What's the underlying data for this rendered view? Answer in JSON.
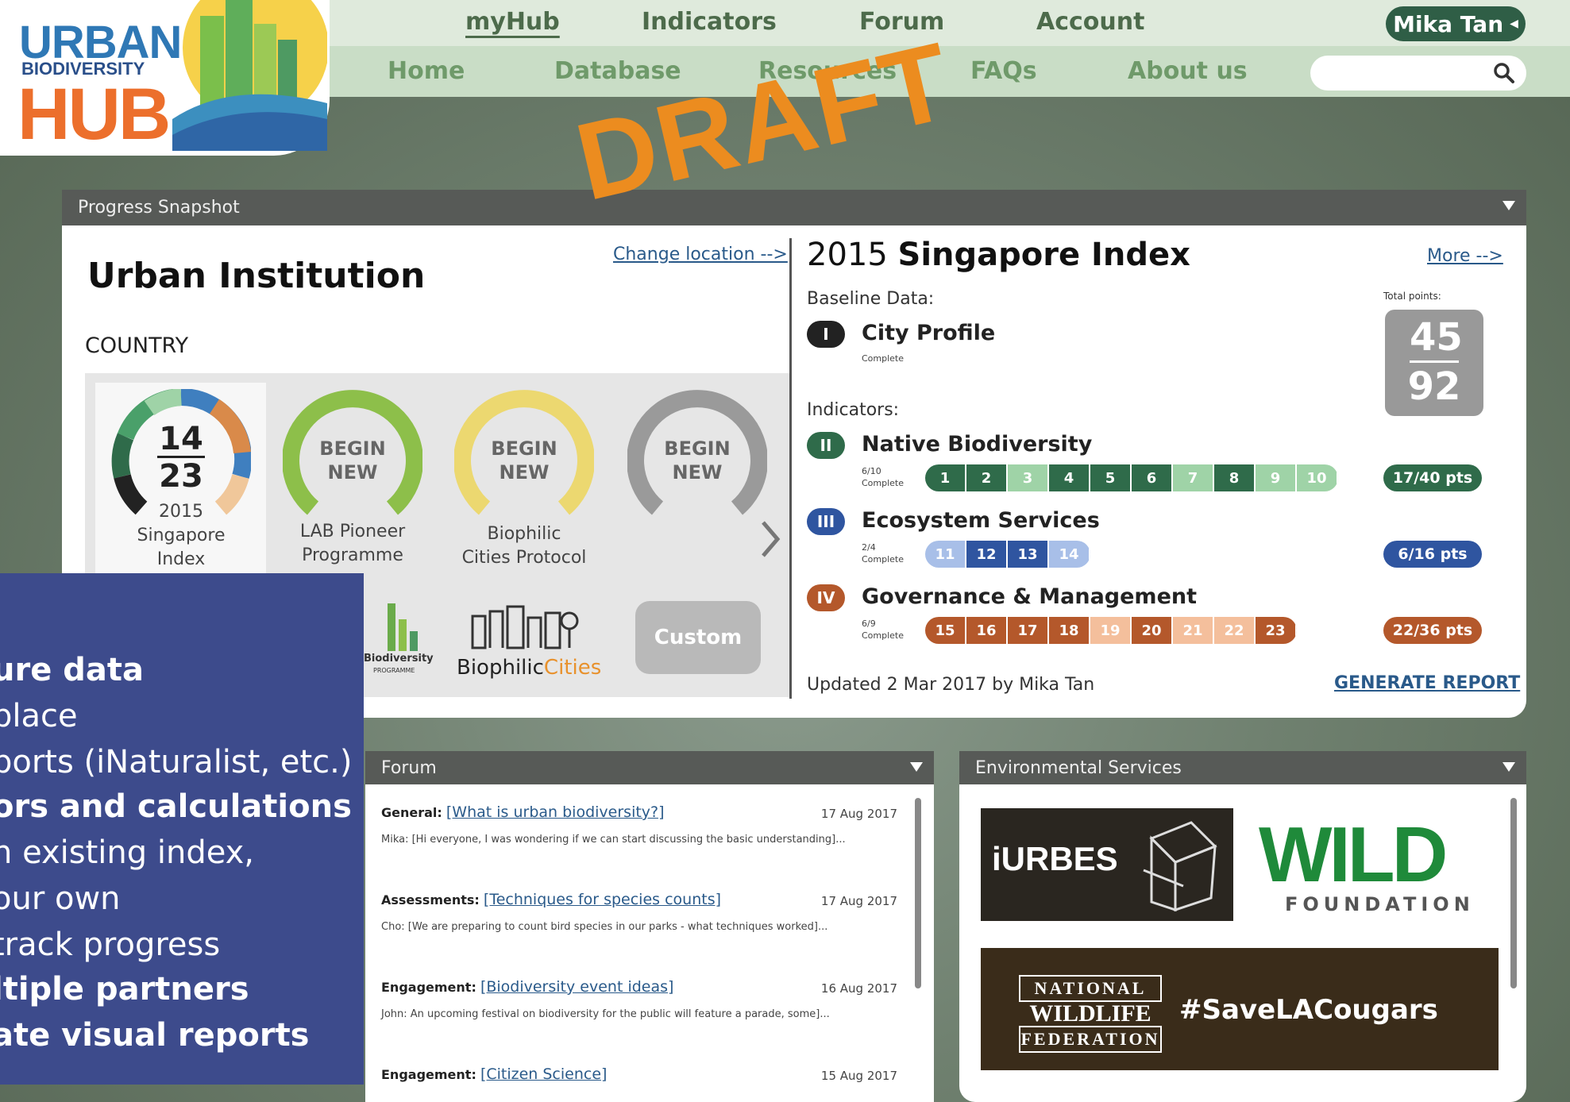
{
  "nav": {
    "top": [
      "myHub",
      "Indicators",
      "Forum",
      "Account"
    ],
    "sub": [
      "Home",
      "Database",
      "Resources",
      "FAQs",
      "About us"
    ],
    "user": "Mika Tan",
    "search_placeholder": ""
  },
  "logo": {
    "line1": "URBAN",
    "line2": "BIODIVERSITY",
    "line3": "HUB"
  },
  "watermark": "DRAFT",
  "snapshot": {
    "header": "Progress Snapshot",
    "institution": "Urban Institution",
    "country": "COUNTRY",
    "change_location": "Change location -->",
    "dials": [
      {
        "score": "14",
        "total": "23",
        "label": [
          "2015",
          "Singapore",
          "Index"
        ]
      },
      {
        "begin": [
          "BEGIN",
          "NEW"
        ],
        "label": [
          "LAB Pioneer",
          "Programme"
        ],
        "color": "#8dbf4a"
      },
      {
        "begin": [
          "BEGIN",
          "NEW"
        ],
        "label": [
          "Biophilic",
          "Cities Protocol"
        ],
        "color": "#ecd870"
      },
      {
        "begin": [
          "BEGIN",
          "NEW"
        ],
        "label": [],
        "color": "#9a9a9a"
      }
    ],
    "lower_logos": {
      "biodiversity": "Biodiversity",
      "programme": "PROGRAMME",
      "biophilic": "Biophilic",
      "cities": "Cities"
    },
    "custom_button": "Custom"
  },
  "index": {
    "year": "2015",
    "title": "Singapore Index",
    "more": "More -->",
    "baseline_label": "Baseline Data:",
    "total_points_label": "Total points:",
    "total_score": "45",
    "total_max": "92",
    "city_profile": {
      "roman": "I",
      "title": "City Profile",
      "status": "Complete"
    },
    "indicators_label": "Indicators:",
    "indicators": [
      {
        "roman": "II",
        "title": "Native Biodiversity",
        "progress": "6/10",
        "status": "Complete",
        "points": "17/40 pts",
        "color": "#2f6b4a",
        "light": "#9fd3a7",
        "chips": [
          [
            "1",
            1
          ],
          [
            "2",
            1
          ],
          [
            "3",
            0
          ],
          [
            "4",
            1
          ],
          [
            "5",
            1
          ],
          [
            "6",
            1
          ],
          [
            "7",
            0
          ],
          [
            "8",
            1
          ],
          [
            "9",
            0
          ],
          [
            "10",
            0
          ]
        ]
      },
      {
        "roman": "III",
        "title": "Ecosystem Services",
        "progress": "2/4",
        "status": "Complete",
        "points": "6/16 pts",
        "color": "#2f55a0",
        "light": "#a8bfe8",
        "chips": [
          [
            "11",
            0
          ],
          [
            "12",
            1
          ],
          [
            "13",
            1
          ],
          [
            "14",
            0
          ]
        ]
      },
      {
        "roman": "IV",
        "title": "Governance & Management",
        "progress": "6/9",
        "status": "Complete",
        "points": "22/36 pts",
        "color": "#b4582b",
        "light": "#f4bf9c",
        "chips": [
          [
            "15",
            1
          ],
          [
            "16",
            1
          ],
          [
            "17",
            1
          ],
          [
            "18",
            1
          ],
          [
            "19",
            0
          ],
          [
            "20",
            1
          ],
          [
            "21",
            0
          ],
          [
            "22",
            0
          ],
          [
            "23",
            1
          ]
        ]
      }
    ],
    "updated": "Updated 2 Mar 2017 by Mika Tan",
    "generate": "GENERATE REPORT"
  },
  "forum": {
    "header": "Forum",
    "items": [
      {
        "cat": "General:",
        "link": "[What is urban biodiversity?]",
        "date": "17 Aug 2017",
        "msg": "Mika:   [Hi everyone, I was wondering if we can start discussing the basic understanding]..."
      },
      {
        "cat": "Assessments:",
        "link": "[Techniques for species counts]",
        "date": "17 Aug 2017",
        "msg": "Cho:   [We are preparing to count bird species in our parks - what techniques worked]..."
      },
      {
        "cat": "Engagement:",
        "link": "[Biodiversity event ideas]",
        "date": "16 Aug 2017",
        "msg": "John:   An upcoming festival on biodiversity for the public will feature a parade, some]..."
      },
      {
        "cat": "Engagement:",
        "link": "[Citizen Science]",
        "date": "15 Aug 2017",
        "msg": ""
      }
    ]
  },
  "env": {
    "header": "Environmental Services",
    "iurbes": "iURBES",
    "wild": "WILD",
    "foundation": "FOUNDATION",
    "nwf": [
      "NATIONAL",
      "WILDLIFE",
      "FEDERATION"
    ],
    "hashtag": "#SaveLACougars"
  },
  "overlay": [
    {
      "t": "ure data",
      "b": true
    },
    {
      "t": "place",
      "b": false
    },
    {
      "t": "ports (iNaturalist, etc.)",
      "b": false
    },
    {
      "t": "ors and calculations",
      "b": true
    },
    {
      "t": "n existing index,",
      "b": false
    },
    {
      "t": "our own",
      "b": false
    },
    {
      "t": " track progress",
      "b": false
    },
    {
      "t": "ltiple partners",
      "b": true
    },
    {
      "t": "ate visual reports",
      "b": true
    }
  ]
}
